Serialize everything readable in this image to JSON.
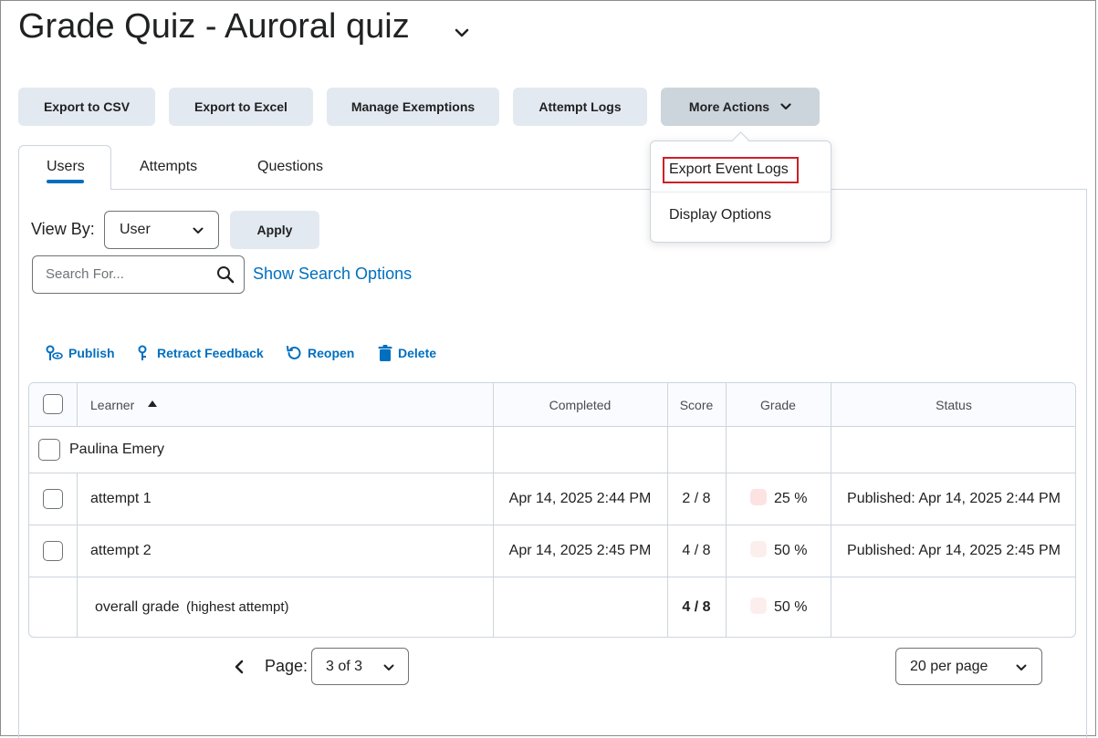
{
  "page": {
    "title": "Grade Quiz - Auroral quiz"
  },
  "toolbar": {
    "export_csv": "Export to CSV",
    "export_excel": "Export to Excel",
    "manage_exemptions": "Manage Exemptions",
    "attempt_logs": "Attempt Logs",
    "more_actions": "More Actions"
  },
  "more_actions_menu": {
    "items": [
      "Export Event Logs",
      "Display Options"
    ]
  },
  "tabs": [
    {
      "label": "Users"
    },
    {
      "label": "Attempts"
    },
    {
      "label": "Questions"
    }
  ],
  "view_by": {
    "label": "View By:",
    "value": "User",
    "apply": "Apply"
  },
  "search": {
    "placeholder": "Search For...",
    "options_link": "Show Search Options"
  },
  "actions": {
    "publish": "Publish",
    "retract": "Retract Feedback",
    "reopen": "Reopen",
    "delete": "Delete"
  },
  "table": {
    "headers": {
      "learner": "Learner",
      "completed": "Completed",
      "score": "Score",
      "grade": "Grade",
      "status": "Status"
    },
    "group": "Paulina Emery",
    "rows": [
      {
        "name": "attempt 1",
        "completed": "Apr 14, 2025 2:44 PM",
        "score": "2 / 8",
        "grade": "25 %",
        "status": "Published: Apr 14, 2025 2:44 PM"
      },
      {
        "name": "attempt 2",
        "completed": "Apr 14, 2025 2:45 PM",
        "score": "4 / 8",
        "grade": "50 %",
        "status": "Published: Apr 14, 2025 2:45 PM"
      }
    ],
    "overall": {
      "name": "overall grade",
      "note": "(highest attempt)",
      "score": "4 / 8",
      "grade": "50 %"
    }
  },
  "pager": {
    "label": "Page:",
    "value": "3 of 3",
    "per_page": "20 per page"
  },
  "colors": {
    "link": "#006fbf",
    "button_bg": "#e3e9f1",
    "highlight_border": "#cd2026",
    "grade_low": "#fde2e2",
    "grade_mid": "#fdeeee"
  }
}
